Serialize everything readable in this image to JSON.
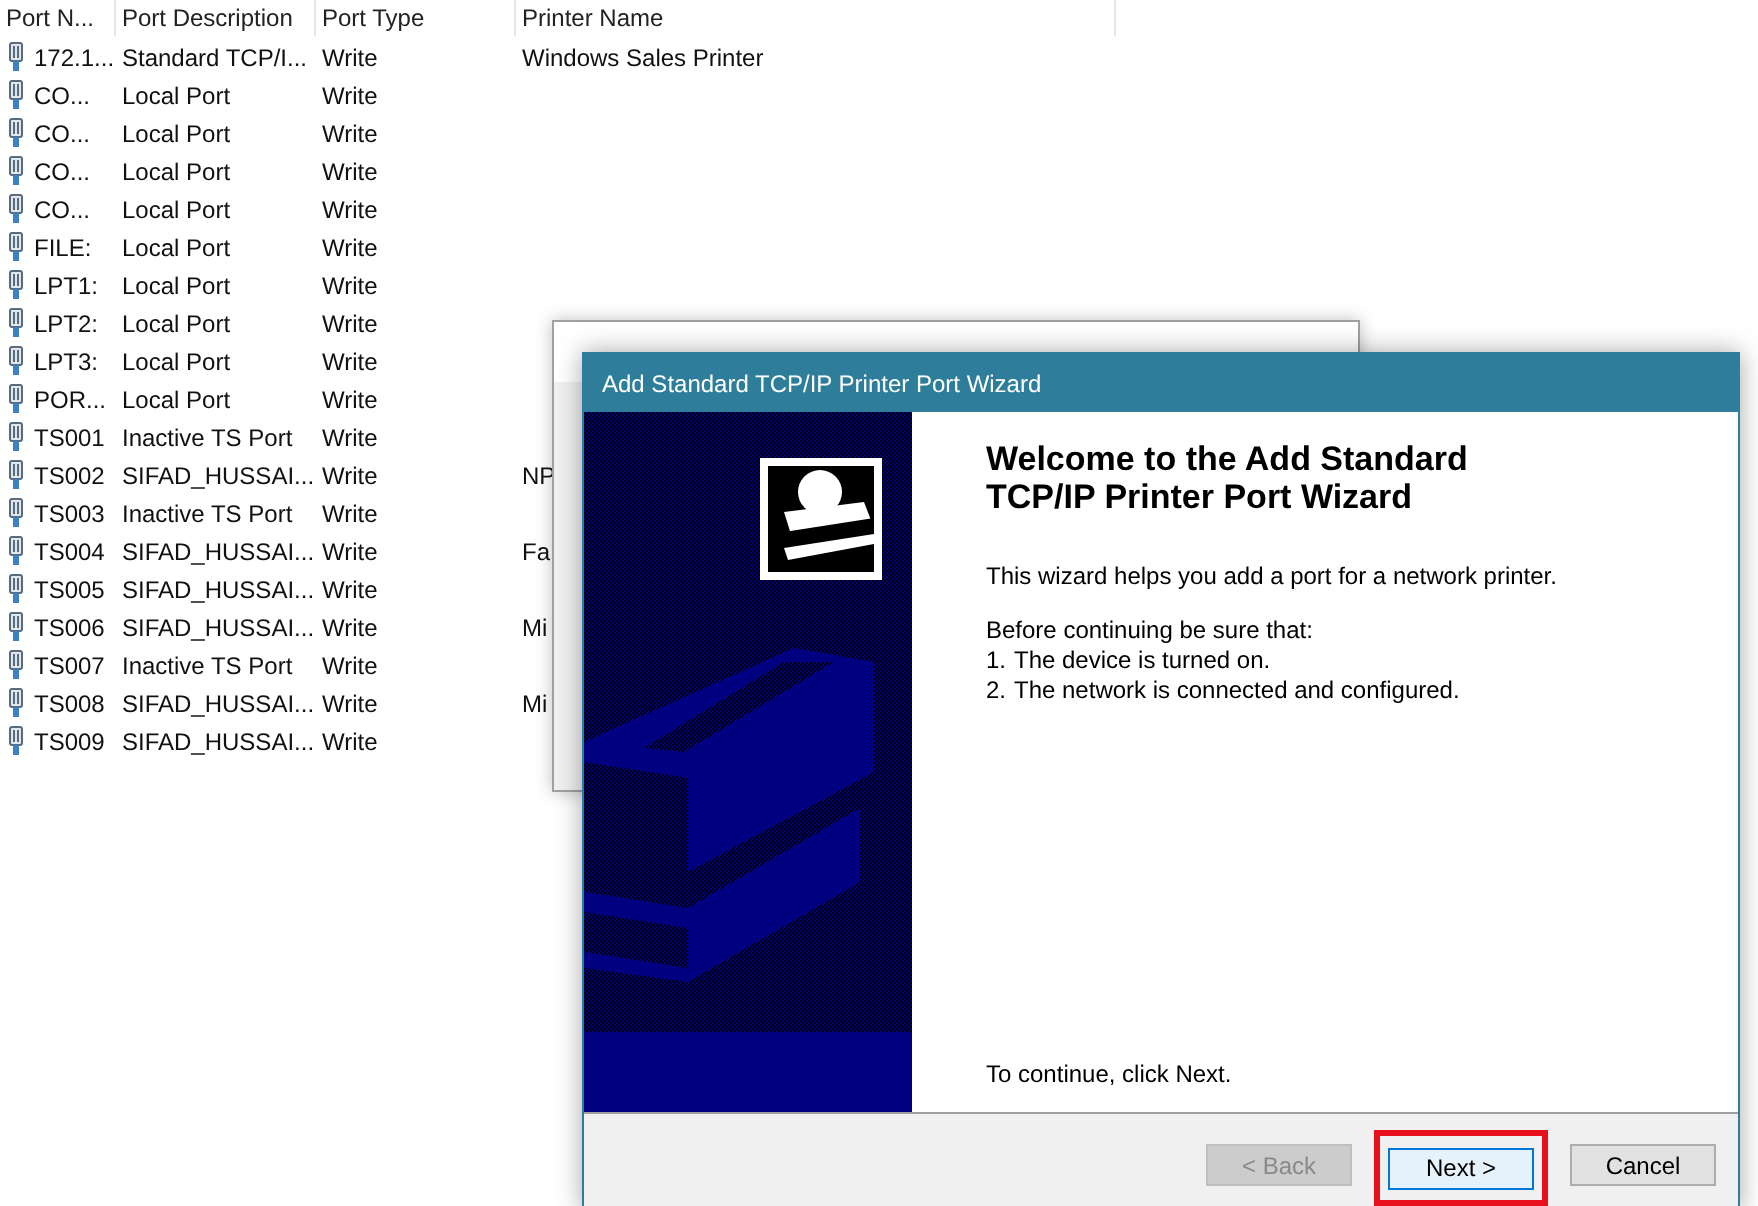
{
  "port_list": {
    "columns": [
      "Port N...",
      "Port Description",
      "Port Type",
      "Printer Name"
    ],
    "rows": [
      {
        "name": "172.1...",
        "description": "Standard TCP/I...",
        "type": "Write",
        "printer": "Windows Sales Printer"
      },
      {
        "name": "CO...",
        "description": "Local Port",
        "type": "Write"
      },
      {
        "name": "CO...",
        "description": "Local Port",
        "type": "Write"
      },
      {
        "name": "CO...",
        "description": "Local Port",
        "type": "Write"
      },
      {
        "name": "CO...",
        "description": "Local Port",
        "type": "Write"
      },
      {
        "name": "FILE:",
        "description": "Local Port",
        "type": "Write"
      },
      {
        "name": "LPT1:",
        "description": "Local Port",
        "type": "Write"
      },
      {
        "name": "LPT2:",
        "description": "Local Port",
        "type": "Write"
      },
      {
        "name": "LPT3:",
        "description": "Local Port",
        "type": "Write"
      },
      {
        "name": "POR...",
        "description": "Local Port",
        "type": "Write"
      },
      {
        "name": "TS001",
        "description": "Inactive TS Port",
        "type": "Write"
      },
      {
        "name": "TS002",
        "description": "SIFAD_HUSSAI...",
        "type": "Write",
        "printer": "NP"
      },
      {
        "name": "TS003",
        "description": "Inactive TS Port",
        "type": "Write"
      },
      {
        "name": "TS004",
        "description": "SIFAD_HUSSAI...",
        "type": "Write",
        "printer": "Fa"
      },
      {
        "name": "TS005",
        "description": "SIFAD_HUSSAI...",
        "type": "Write"
      },
      {
        "name": "TS006",
        "description": "SIFAD_HUSSAI...",
        "type": "Write",
        "printer": "Mi"
      },
      {
        "name": "TS007",
        "description": "Inactive TS Port",
        "type": "Write"
      },
      {
        "name": "TS008",
        "description": "SIFAD_HUSSAI...",
        "type": "Write",
        "printer": "Mi"
      },
      {
        "name": "TS009",
        "description": "SIFAD_HUSSAI...",
        "type": "Write"
      }
    ]
  },
  "wizard": {
    "title": "Add Standard TCP/IP Printer Port Wizard",
    "heading": "Welcome to the Add Standard TCP/IP Printer Port Wizard",
    "intro": "This wizard helps you add a port for a network printer.",
    "checklist_title": "Before continuing be sure that:",
    "checklist": [
      {
        "number": "1.",
        "text": "The device is turned on."
      },
      {
        "number": "2.",
        "text": "The network is connected and configured."
      }
    ],
    "footer_note": "To continue, click Next.",
    "buttons": [
      {
        "label": "< Back",
        "disabled": true,
        "highlighted": false
      },
      {
        "label": "Next >",
        "disabled": false,
        "highlighted": true
      },
      {
        "label": "Cancel",
        "disabled": false,
        "highlighted": false
      }
    ]
  }
}
